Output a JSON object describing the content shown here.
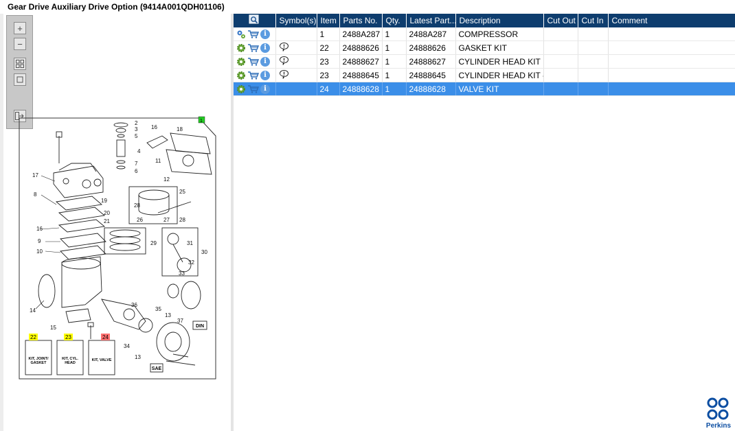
{
  "window": {
    "title": "Gear Drive Auxiliary Drive Option (9414A001QDH01106)"
  },
  "toolbar": {
    "zoom_in_icon": "plus-icon",
    "zoom_out_icon": "minus-icon",
    "fit_icon": "fit-all-icon",
    "actual_icon": "actual-size-icon",
    "export_icon": "export-icon"
  },
  "diagram": {
    "callout_numbers": [
      "1",
      "2",
      "3",
      "4",
      "5",
      "6",
      "7",
      "8",
      "9",
      "10",
      "11",
      "12",
      "13",
      "13",
      "14",
      "15",
      "16",
      "16",
      "17",
      "18",
      "19",
      "20",
      "21",
      "25",
      "26",
      "27",
      "28",
      "28",
      "29",
      "30",
      "31",
      "32",
      "33",
      "34",
      "35",
      "36",
      "37"
    ],
    "tags": [
      "22",
      "23",
      "24"
    ],
    "kit_labels": {
      "gasket": "KIT, JOINT/ GASKET",
      "head": "KIT, CYL. HEAD",
      "valve": "KIT, VALVE"
    },
    "badges": {
      "din": "DIN",
      "sae": "SAE"
    }
  },
  "grid": {
    "columns": [
      "",
      "Symbol(s)",
      "Item",
      "Parts No.",
      "Qty.",
      "Latest Part...",
      "Description",
      "Cut Out",
      "Cut In",
      "Comment"
    ],
    "rows": [
      {
        "item": "1",
        "parts_no": "2488A287",
        "qty": "1",
        "latest": "2488A287",
        "description": "COMPRESSOR",
        "cut_out": "",
        "cut_in": "",
        "comment": "",
        "has_symbol": false,
        "selected": false,
        "gear_variant": "multi"
      },
      {
        "item": "22",
        "parts_no": "24888626",
        "qty": "1",
        "latest": "24888626",
        "description": "GASKET KIT",
        "cut_out": "",
        "cut_in": "",
        "comment": "",
        "has_symbol": true,
        "selected": false,
        "gear_variant": "single"
      },
      {
        "item": "23",
        "parts_no": "24888627",
        "qty": "1",
        "latest": "24888627",
        "description": "CYLINDER HEAD KIT",
        "cut_out": "",
        "cut_in": "",
        "comment": "",
        "has_symbol": true,
        "selected": false,
        "gear_variant": "single"
      },
      {
        "item": "23",
        "parts_no": "24888645",
        "qty": "1",
        "latest": "24888645",
        "description": "CYLINDER HEAD KIT - CO",
        "cut_out": "",
        "cut_in": "",
        "comment": "",
        "has_symbol": true,
        "selected": false,
        "gear_variant": "single"
      },
      {
        "item": "24",
        "parts_no": "24888628",
        "qty": "1",
        "latest": "24888628",
        "description": "VALVE KIT",
        "cut_out": "",
        "cut_in": "",
        "comment": "",
        "has_symbol": false,
        "selected": true,
        "gear_variant": "single"
      }
    ]
  },
  "brand": {
    "logo_text": "Perkins",
    "color": "#0c4ea2"
  },
  "colors": {
    "header_bg": "#0e3d6e",
    "selected_row": "#3b8ee8",
    "tag_yellow": "#ffff00",
    "tag_red": "#ff7070",
    "tag_green": "#22cc22"
  }
}
